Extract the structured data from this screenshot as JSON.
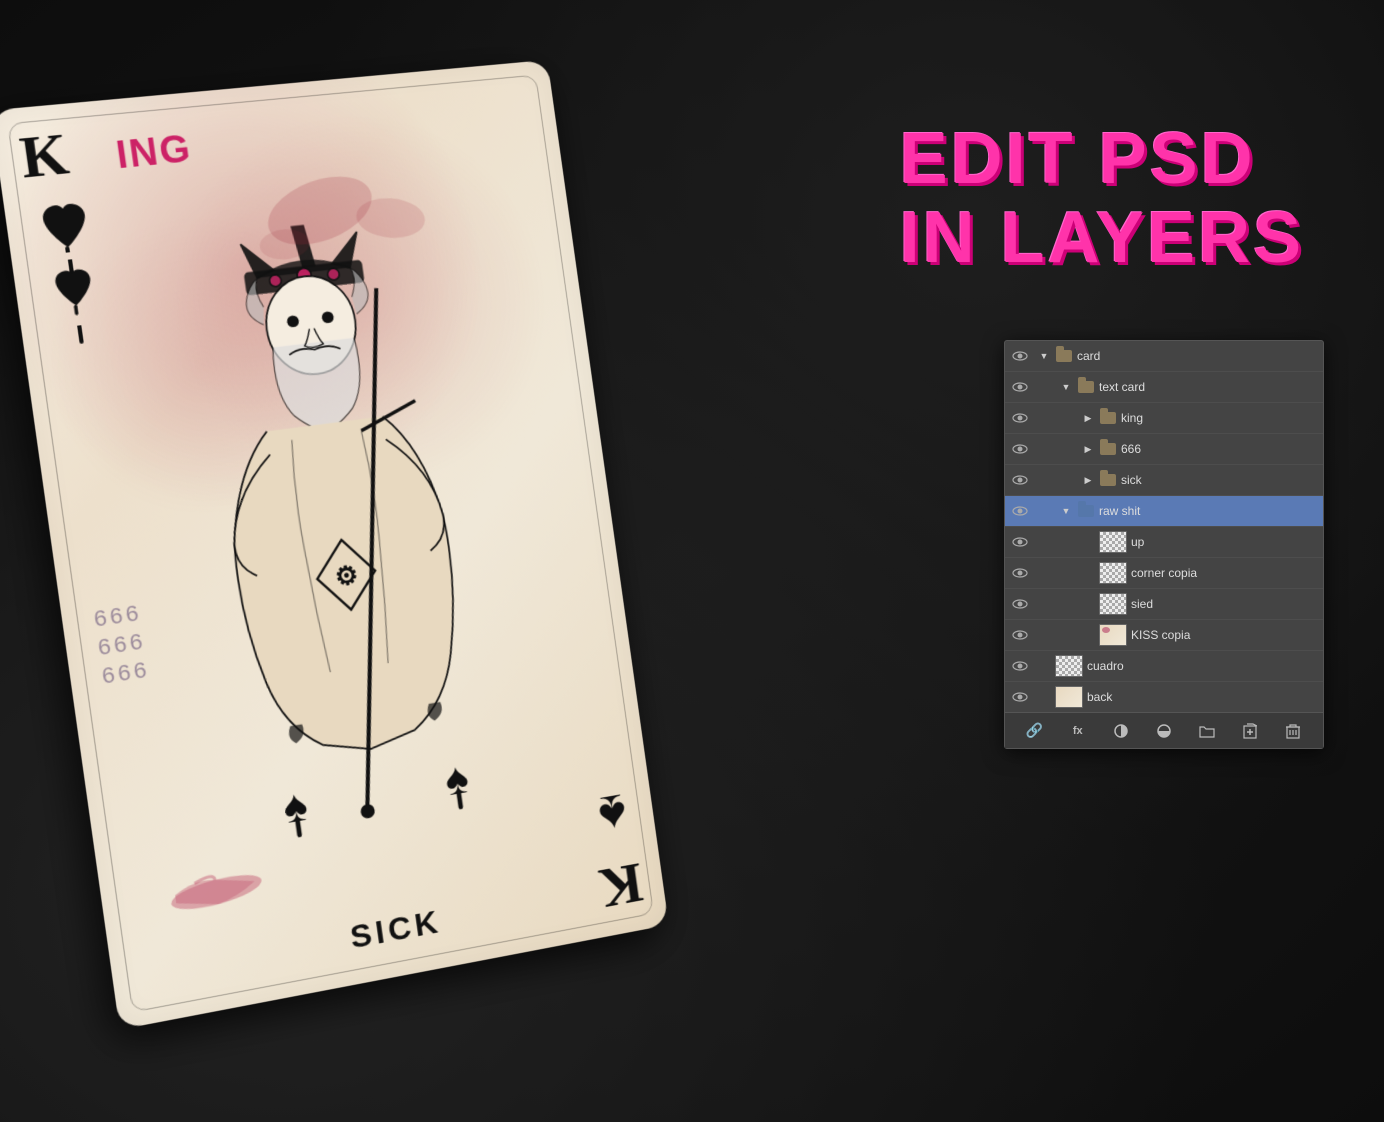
{
  "background": {
    "color": "#111111"
  },
  "title": {
    "line1": "EDIT PSD",
    "line2": "IN LAYERS"
  },
  "layers_panel": {
    "layers": [
      {
        "id": "card",
        "label": "card",
        "indent": 0,
        "type": "folder",
        "expanded": true,
        "eye": true,
        "arrow": "down"
      },
      {
        "id": "text-card",
        "label": "text card",
        "indent": 1,
        "type": "folder",
        "expanded": true,
        "eye": true,
        "arrow": "down"
      },
      {
        "id": "king",
        "label": "king",
        "indent": 2,
        "type": "folder",
        "expanded": false,
        "eye": true,
        "arrow": "right"
      },
      {
        "id": "666",
        "label": "666",
        "indent": 2,
        "type": "folder",
        "expanded": false,
        "eye": true,
        "arrow": "right"
      },
      {
        "id": "sick",
        "label": "sick",
        "indent": 2,
        "type": "folder",
        "expanded": false,
        "eye": true,
        "arrow": "right"
      },
      {
        "id": "raw-shit",
        "label": "raw shit",
        "indent": 1,
        "type": "folder",
        "expanded": true,
        "eye": true,
        "arrow": "down",
        "active": true
      },
      {
        "id": "up",
        "label": "up",
        "indent": 2,
        "type": "layer",
        "eye": true,
        "thumb": "checker"
      },
      {
        "id": "corner-copia",
        "label": "corner copia",
        "indent": 2,
        "type": "layer",
        "eye": true,
        "thumb": "checker"
      },
      {
        "id": "sied",
        "label": "sied",
        "indent": 2,
        "type": "layer",
        "eye": true,
        "thumb": "checker"
      },
      {
        "id": "kiss-copia",
        "label": "KISS copia",
        "indent": 2,
        "type": "layer",
        "eye": true,
        "thumb": "pink-spot"
      },
      {
        "id": "cuadro",
        "label": "cuadro",
        "indent": 0,
        "type": "layer",
        "eye": true,
        "thumb": "checker"
      },
      {
        "id": "back",
        "label": "back",
        "indent": 0,
        "type": "layer",
        "eye": true,
        "thumb": "beige"
      }
    ],
    "toolbar": {
      "link_icon": "🔗",
      "fx_icon": "fx",
      "circle_icon": "⊙",
      "half_circle_icon": "◑",
      "folder_icon": "📁",
      "page_icon": "⎘",
      "trash_icon": "🗑"
    }
  },
  "card": {
    "k_label": "K",
    "king_label": "ING",
    "sick_label": "SICK",
    "hearts": [
      "♥",
      "♥"
    ],
    "suit_bottom": "♠"
  }
}
